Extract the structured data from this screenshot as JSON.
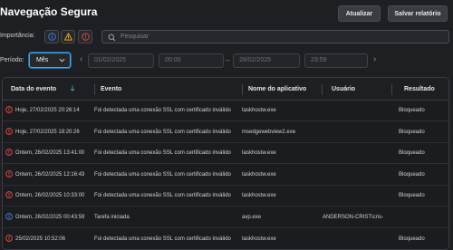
{
  "header": {
    "title": "Navegação Segura",
    "update_label": "Atualizar",
    "save_label": "Salvar relatório"
  },
  "filters": {
    "importance_label": "Importância:",
    "search_placeholder": "Pesquisar",
    "period_label": "Período:",
    "period_value": "Mês",
    "start_date": "01/02/2025",
    "start_time": "00:00",
    "end_date": "28/02/2025",
    "end_time": "23:59",
    "dash": "–",
    "prev_arrow": "‹",
    "next_arrow": "›"
  },
  "colors": {
    "error": "#e0483e",
    "info": "#3b7ddd",
    "warning": "#e8a52a",
    "accent": "#4aa5e0"
  },
  "table": {
    "columns": [
      "Data do evento",
      "Evento",
      "Nome do aplicativo",
      "Usuário",
      "Resultado"
    ],
    "rows": [
      {
        "icon": "error-icon",
        "date": "Hoje, 27/02/2025 20:26:14",
        "event": "Foi detectada uma conexão SSL com certificado inválido",
        "app": "taskhostw.exe",
        "user": "",
        "result": "Bloqueado"
      },
      {
        "icon": "error-icon",
        "date": "Hoje, 27/02/2025 18:20:26",
        "event": "Foi detectada uma conexão SSL com certificado inválido",
        "app": "msedgewebview2.exe",
        "user": "",
        "result": "Bloqueado"
      },
      {
        "icon": "error-icon",
        "date": "Ontem, 26/02/2025 13:41:00",
        "event": "Foi detectada uma conexão SSL com certificado inválido",
        "app": "taskhostw.exe",
        "user": "",
        "result": "Bloqueado"
      },
      {
        "icon": "error-icon",
        "date": "Ontem, 26/02/2025 12:16:43",
        "event": "Foi detectada uma conexão SSL com certificado inválido",
        "app": "taskhostw.exe",
        "user": "",
        "result": "Bloqueado"
      },
      {
        "icon": "error-icon",
        "date": "Ontem, 26/02/2025 10:33:00",
        "event": "Foi detectada uma conexão SSL com certificado inválido",
        "app": "taskhostw.exe",
        "user": "",
        "result": "Bloqueado"
      },
      {
        "icon": "info-icon",
        "date": "Ontem, 26/02/2025 00:43:59",
        "event": "Tarefa iniciada",
        "app": "avp.exe",
        "user": "ANDERSON-CRIST\\cris-",
        "result": ""
      },
      {
        "icon": "error-icon",
        "date": "25/02/2025 10:52:06",
        "event": "Foi detectada uma conexão SSL com certificado inválido",
        "app": "taskhostw.exe",
        "user": "",
        "result": "Bloqueado"
      }
    ]
  }
}
